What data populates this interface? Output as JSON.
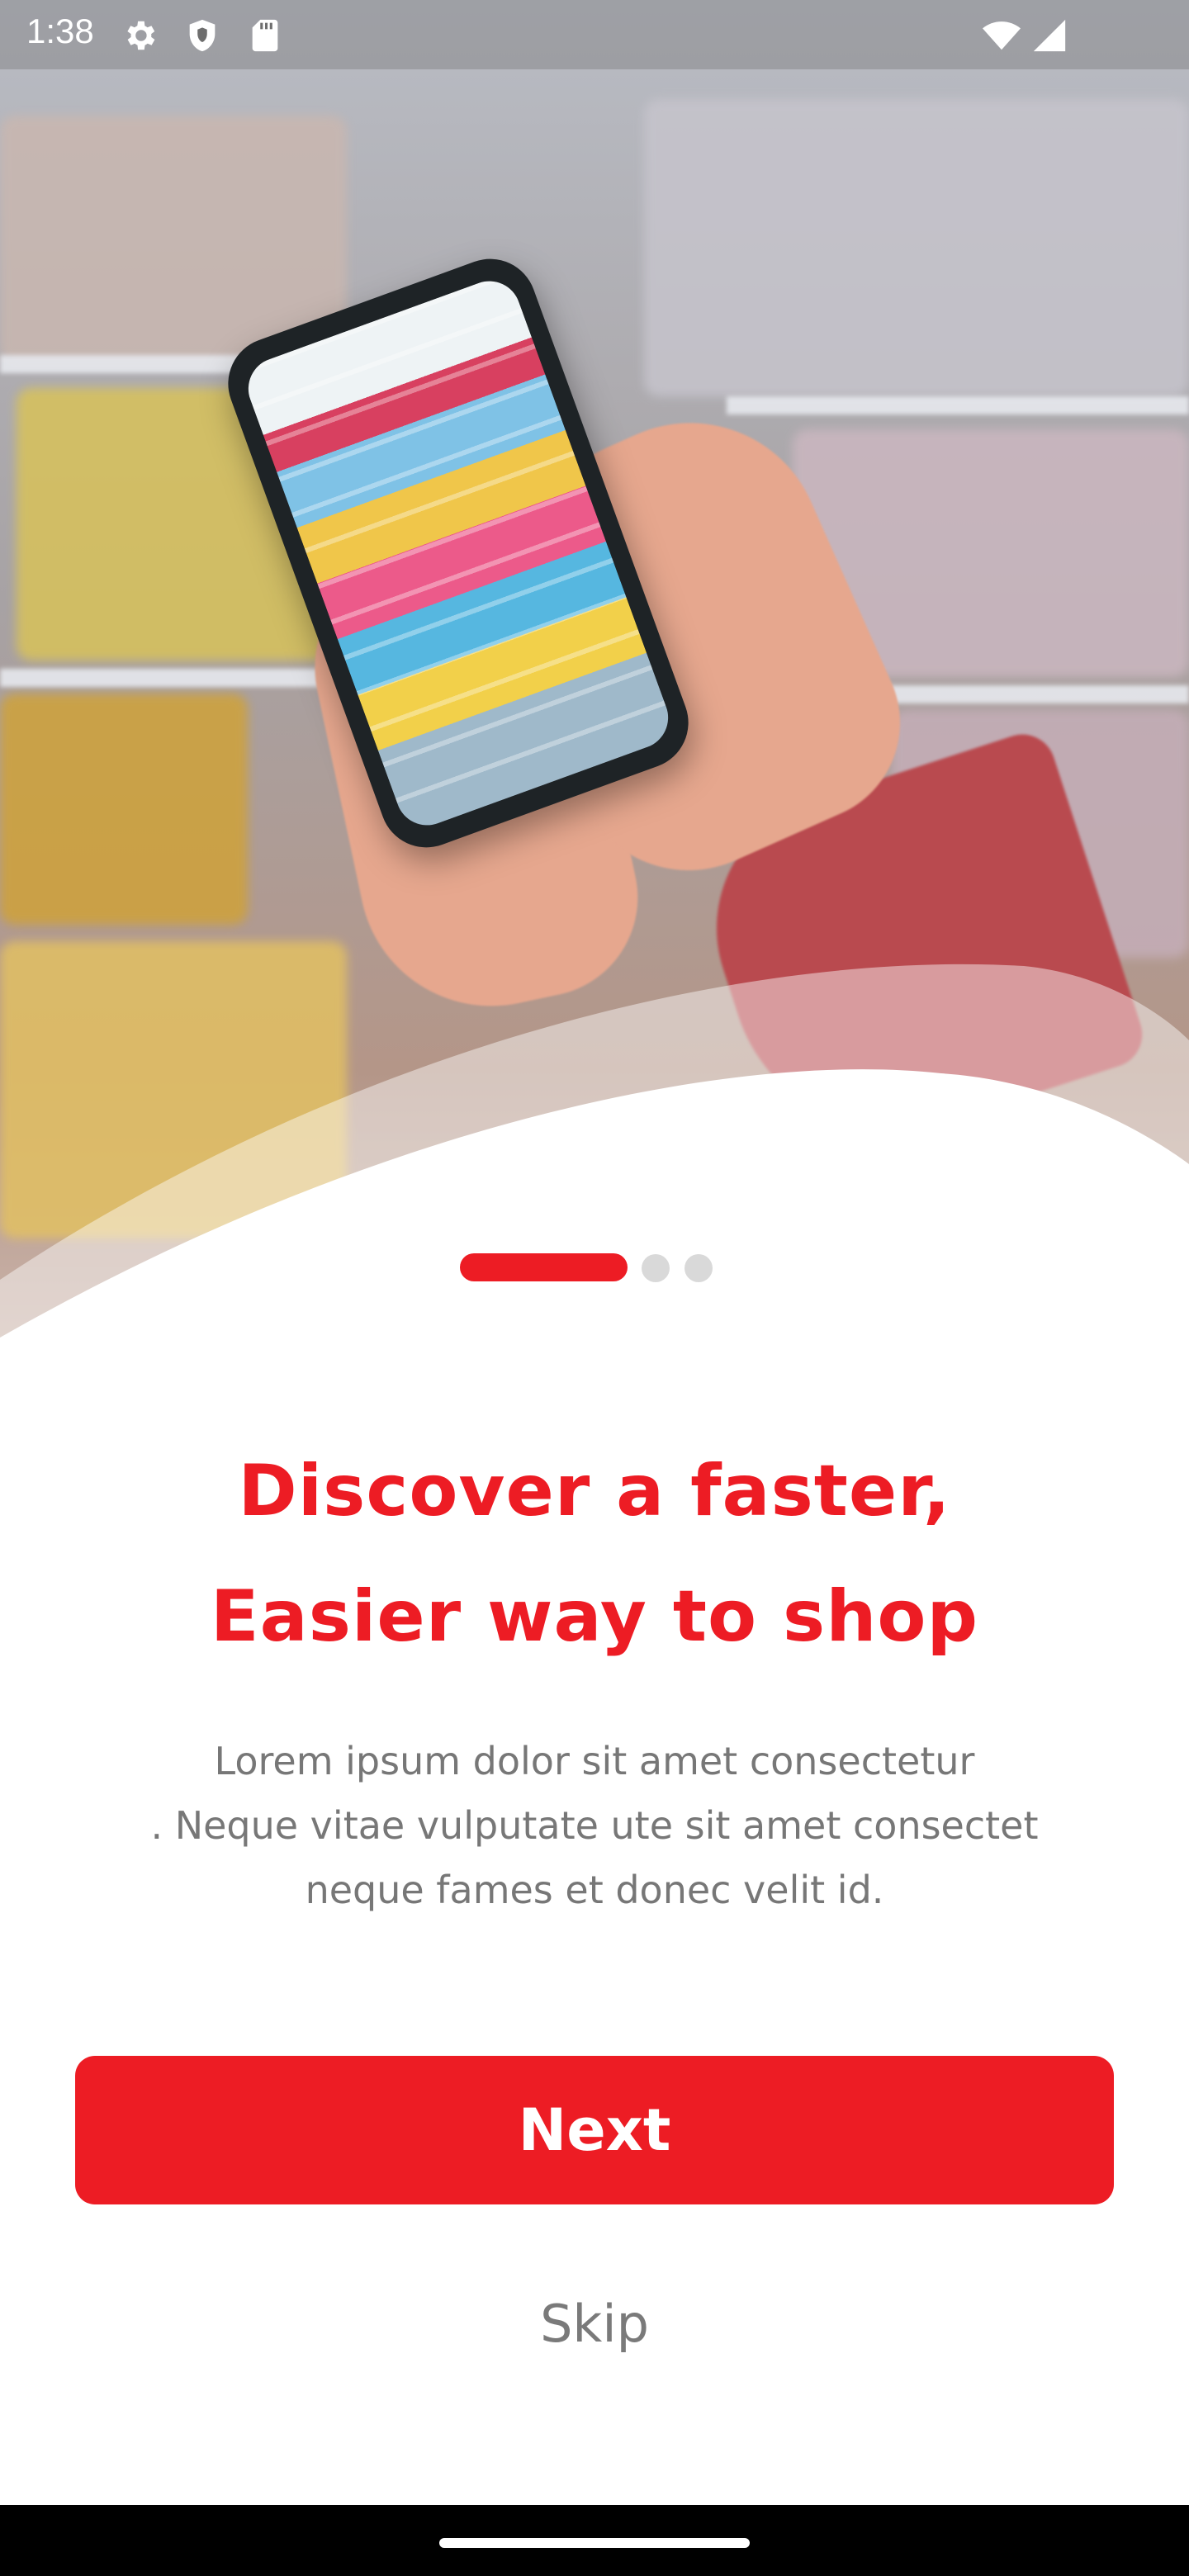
{
  "status_bar": {
    "time": "1:38",
    "left_icons": [
      "gear-icon",
      "shield-icon",
      "sd-card-icon"
    ],
    "right_icons": [
      "wifi-icon",
      "signal-icon"
    ]
  },
  "hero": {
    "image": "hand-holding-phone-in-grocery-aisle"
  },
  "pager": {
    "total": 3,
    "active_index": 0
  },
  "onboarding": {
    "title_line1": "Discover a faster,",
    "title_line2": "Easier way to shop",
    "body_line1": "Lorem ipsum dolor sit amet consectetur",
    "body_line2": ". Neque vitae vulputate ute sit amet consectet",
    "body_line3": "neque fames et donec velit id."
  },
  "actions": {
    "next_label": "Next",
    "skip_label": "Skip"
  },
  "colors": {
    "accent": "#ED1C24",
    "body_text": "#777777",
    "inactive_dot": "#D9D9D9"
  }
}
